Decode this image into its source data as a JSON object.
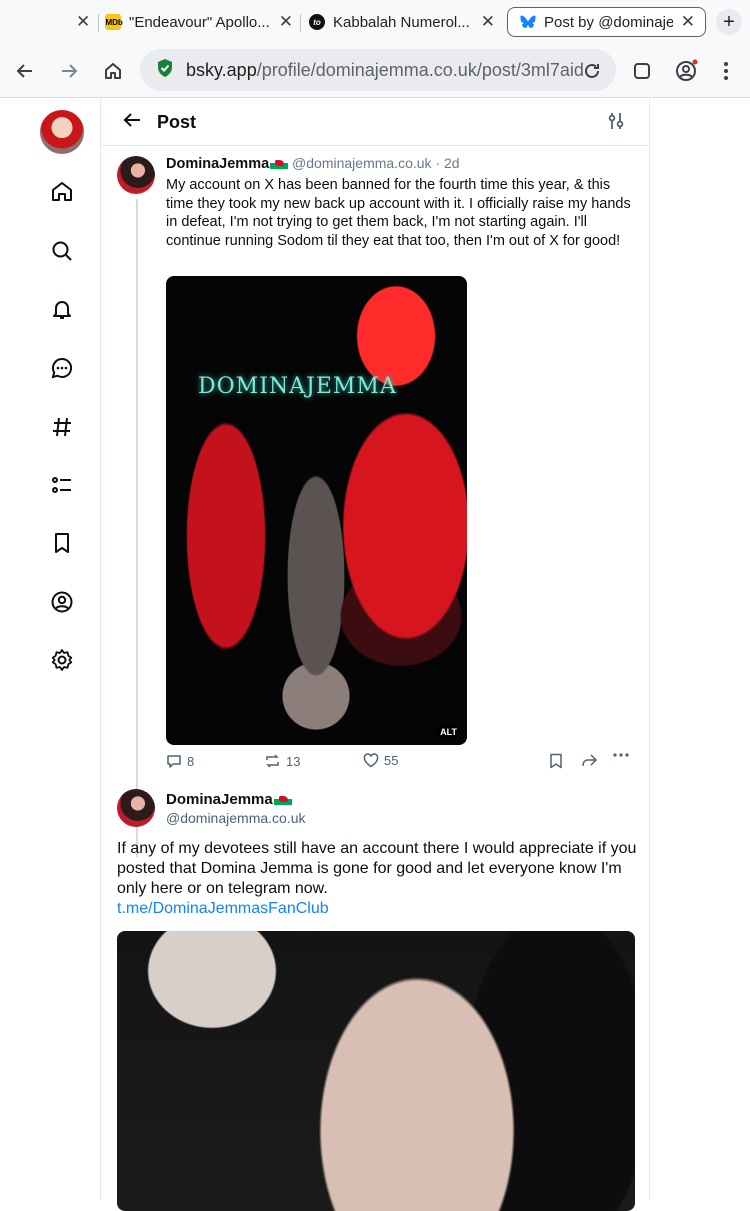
{
  "browser": {
    "tabs": [
      {
        "title": "",
        "favicon": "partial-tab",
        "active": false
      },
      {
        "title": "\"Endeavour\" Apollo...",
        "favicon": "imdb-icon",
        "active": false
      },
      {
        "title": "Kabbalah Numerol...",
        "favicon": "to-icon",
        "active": false
      },
      {
        "title": "Post by @dominaje...",
        "favicon": "bluesky-butterfly-icon",
        "active": true
      }
    ],
    "new_tab": "+",
    "url_host": "bsky.app",
    "url_path": "/profile/dominajemma.co.uk/post/3ml7aid"
  },
  "app": {
    "header_title": "Post",
    "nav_items": [
      "home-icon",
      "search-icon",
      "notifications-bell-icon",
      "chat-icon",
      "feeds-hashtag-icon",
      "lists-icon",
      "bookmark-icon",
      "profile-icon",
      "settings-gear-icon"
    ],
    "accent_color": "#1083fe"
  },
  "post1": {
    "display_name": "DominaJemma",
    "handle": "@dominajemma.co.uk",
    "age": "· 2d",
    "text": "My account on X has been banned for the fourth time this year, & this time they took my new back up account with it. I officially raise my hands in defeat, I'm not trying to get them back, I'm not starting again. I'll continue running Sodom til they eat that too, then I'm out of X for good!",
    "image_watermark": "DOMINAJEMMA",
    "alt_badge": "ALT",
    "replies": "8",
    "reposts": "13",
    "likes": "55"
  },
  "post2": {
    "display_name": "DominaJemma",
    "handle": "@dominajemma.co.uk",
    "text": "If any of my devotees still have an account there I would appreciate if you posted that Domina Jemma is gone for good and let everyone know I'm only here or on telegram now.",
    "link": "t.me/DominaJemmasFanClub"
  }
}
